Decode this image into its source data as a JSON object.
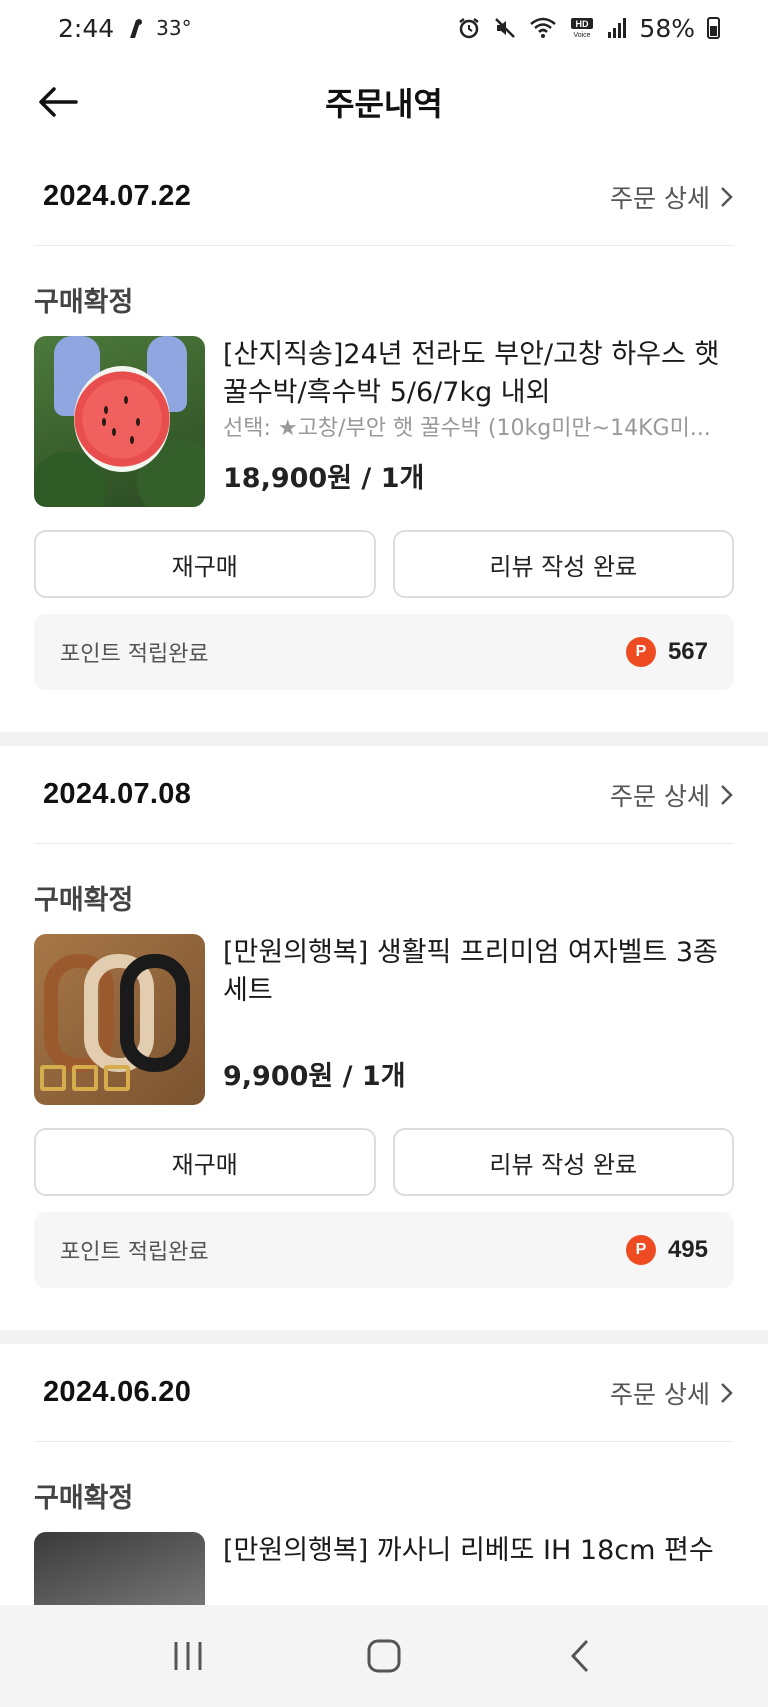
{
  "status_bar": {
    "time": "2:44",
    "temperature": "33°",
    "battery": "58%"
  },
  "header": {
    "title": "주문내역"
  },
  "orders": [
    {
      "date": "2024.07.22",
      "detail_label": "주문 상세",
      "status": "구매확정",
      "product_name": "[산지직송]24년 전라도 부안/고창 하우스 햇꿀수박/흑수박 5/6/7kg 내외",
      "option": "선택: ★고창/부안 햇 꿀수박 (10kg미만~14KG미...",
      "price": "18,900원 / 1개",
      "rebuy_label": "재구매",
      "review_label": "리뷰 작성 완료",
      "point_label": "포인트 적립완료",
      "point_badge": "P",
      "point_value": "567"
    },
    {
      "date": "2024.07.08",
      "detail_label": "주문 상세",
      "status": "구매확정",
      "product_name": "[만원의행복] 생활픽 프리미엄 여자벨트 3종세트",
      "option": "",
      "price": "9,900원 / 1개",
      "rebuy_label": "재구매",
      "review_label": "리뷰 작성 완료",
      "point_label": "포인트 적립완료",
      "point_badge": "P",
      "point_value": "495"
    },
    {
      "date": "2024.06.20",
      "detail_label": "주문 상세",
      "status": "구매확정",
      "product_name": "[만원의행복] 까사니 리베또 IH 18cm 편수",
      "option": "",
      "price": ""
    }
  ],
  "colors": {
    "point_badge": "#ef4b23",
    "divider": "#f2f2f2",
    "point_box_bg": "#f6f6f6"
  }
}
